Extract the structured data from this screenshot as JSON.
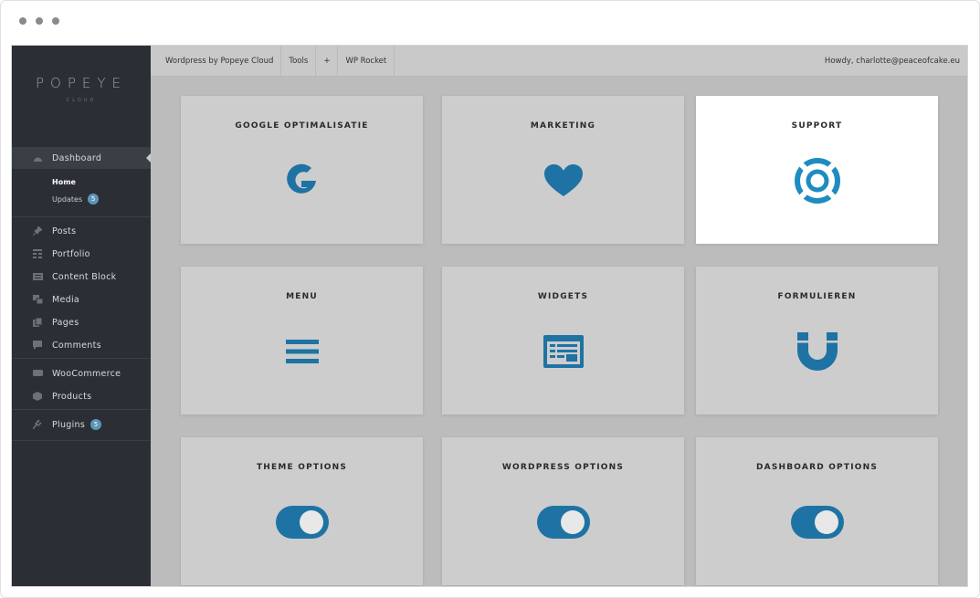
{
  "window": {
    "controls": [
      "dot",
      "dot",
      "dot"
    ]
  },
  "colors": {
    "accent": "#1e73a4",
    "sidebar": "#2b2f35",
    "badge": "#5d95b7"
  },
  "sidebar": {
    "logo": "POPEYE",
    "logo_sub": "CLOUD",
    "dashboard": "Dashboard",
    "home": "Home",
    "updates": "Updates",
    "updates_count": "5",
    "items": [
      {
        "label": "Posts",
        "icon": "pin-icon"
      },
      {
        "label": "Portfolio",
        "icon": "grid-icon"
      },
      {
        "label": "Content Block",
        "icon": "block-icon"
      },
      {
        "label": "Media",
        "icon": "media-icon"
      },
      {
        "label": "Pages",
        "icon": "pages-icon"
      },
      {
        "label": "Comments",
        "icon": "comment-icon"
      }
    ],
    "woocommerce": "WooCommerce",
    "products": "Products",
    "plugins": "Plugins",
    "plugins_count": "5"
  },
  "topbar": {
    "site": "Wordpress by Popeye Cloud",
    "tools": "Tools",
    "plus": "+",
    "rocket": "WP Rocket",
    "howdy": "Howdy, charlotte@peaceofcake.eu"
  },
  "cards": {
    "google": "GOOGLE OPTIMALISATIE",
    "marketing": "MARKETING",
    "support": "SUPPORT",
    "menu": "MENU",
    "widgets": "WIDGETS",
    "forms": "FORMULIEREN",
    "theme": "THEME OPTIONS",
    "wordpress": "WORDPRESS OPTIONS",
    "dashboard": "DASHBOARD OPTIONS"
  }
}
